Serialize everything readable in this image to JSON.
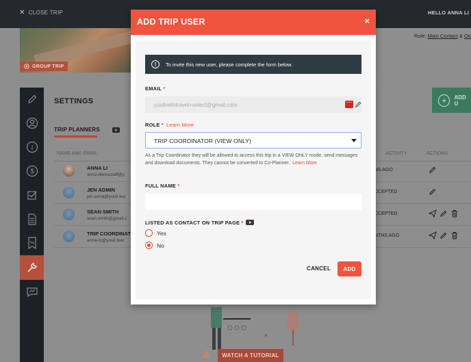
{
  "topbar": {
    "close_trip": "CLOSE TRIP",
    "greeting": "HELLO ANNA LI"
  },
  "hero": {
    "group_trip_label": "GROUP TRIP"
  },
  "role_line": {
    "prefix": "Role: ",
    "main_contact": "Main Contact",
    "sep": " & ",
    "owner": "Ow"
  },
  "settings": {
    "title": "SETTINGS",
    "add_button": "ADD U"
  },
  "tabs": {
    "trip_planners": "TRIP PLANNERS"
  },
  "table": {
    "headers": {
      "name_email": "NAME AND EMAIL",
      "activity": "ACTIVITY",
      "actions": "ACTIONS"
    },
    "rows": [
      {
        "name": "ANNA LI",
        "email": "anna-demostaff@y",
        "status": "NS AGO"
      },
      {
        "name": "JEN ADMIN",
        "email": "jen-anna@youli.tea",
        "status": "CCEPTED"
      },
      {
        "name": "SEAN SMITH",
        "email": "sean.smith@gmail.c",
        "status": "CCEPTED"
      },
      {
        "name": "TRIP COORDINAT",
        "email": "anna-tc@youli.tear",
        "status": "NTHS AGO"
      }
    ]
  },
  "tutorial": {
    "label": "WATCH A TUTORIAL"
  },
  "modal": {
    "title": "ADD TRIP USER",
    "close_glyph": "×",
    "info": "To invite this new user, please complete the form below.",
    "email": {
      "label": "EMAIL",
      "required": "*",
      "value": "youlivetotravel+select@gmail.com"
    },
    "role": {
      "label": "ROLE",
      "required": "*",
      "learn_more": "Learn More",
      "selected": "TRIP COORDINATOR (VIEW ONLY)",
      "help": "As a Trip Coordinator they will be allowed to access this trip in a VIEW ONLY mode, send messages and download documents. They cannot be converted to Co-Planner.",
      "help_learn_more": "Learn More"
    },
    "full_name": {
      "label": "FULL NAME",
      "required": "*",
      "value": ""
    },
    "listed": {
      "label": "LISTED AS CONTACT ON TRIP PAGE",
      "required": "*",
      "options": [
        {
          "label": "Yes",
          "selected": false
        },
        {
          "label": "No",
          "selected": true
        }
      ]
    },
    "cancel_label": "CANCEL",
    "add_label": "ADD"
  },
  "colors": {
    "accent": "#f0533e",
    "dark": "#2f3b43",
    "input_bg": "#ececec"
  }
}
